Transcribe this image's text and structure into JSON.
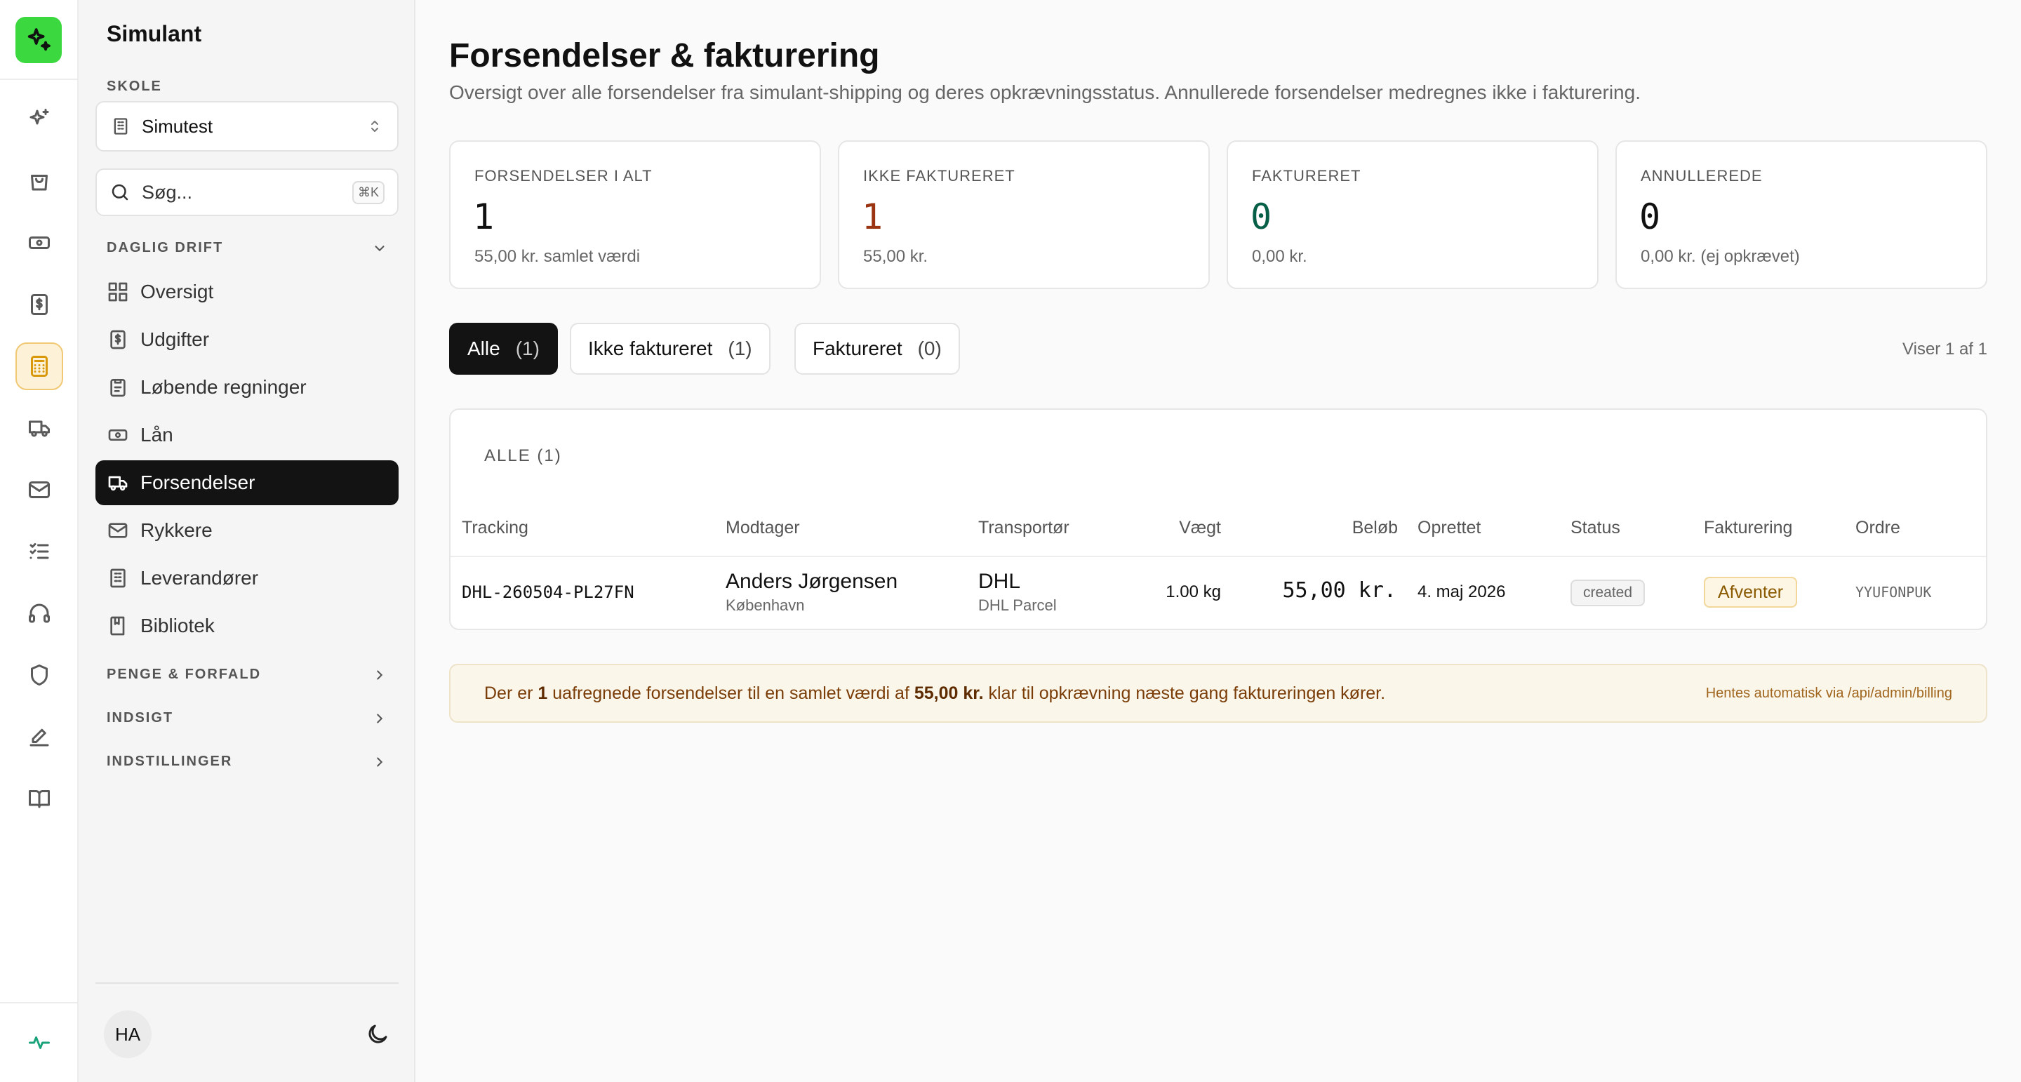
{
  "app": {
    "name": "Simulant"
  },
  "sidebar": {
    "school_label": "SKOLE",
    "school_value": "Simutest",
    "search_placeholder": "Søg...",
    "search_shortcut": "⌘K",
    "groups": [
      {
        "label": "DAGLIG DRIFT",
        "expanded": true,
        "items": [
          {
            "label": "Oversigt",
            "icon": "grid-icon"
          },
          {
            "label": "Udgifter",
            "icon": "dollar-doc-icon"
          },
          {
            "label": "Løbende regninger",
            "icon": "clipboard-icon"
          },
          {
            "label": "Lån",
            "icon": "banknote-icon"
          },
          {
            "label": "Forsendelser",
            "icon": "truck-icon",
            "active": true
          },
          {
            "label": "Rykkere",
            "icon": "mail-icon"
          },
          {
            "label": "Leverandører",
            "icon": "building-icon"
          },
          {
            "label": "Bibliotek",
            "icon": "book-icon"
          }
        ]
      },
      {
        "label": "PENGE & FORFALD",
        "expanded": false
      },
      {
        "label": "INDSIGT",
        "expanded": false
      },
      {
        "label": "INDSTILLINGER",
        "expanded": false
      }
    ],
    "user_initials": "HA"
  },
  "rail": {
    "icons": [
      "sparkles-icon",
      "shopping-bag-icon",
      "banknote-icon",
      "dollar-doc-icon",
      "calculator-icon",
      "truck-icon",
      "mail-icon",
      "list-checks-icon",
      "headphones-icon",
      "shield-icon",
      "pen-icon",
      "book-open-icon",
      "activity-icon"
    ],
    "active": "calculator-icon"
  },
  "page": {
    "title": "Forsendelser & fakturering",
    "subtitle": "Oversigt over alle forsendelser fra simulant-shipping og deres opkrævningsstatus. Annullerede forsendelser medregnes ikke i fakturering."
  },
  "stats": [
    {
      "label": "FORSENDELSER I ALT",
      "value": "1",
      "sub": "55,00 kr. samlet værdi",
      "color": "#111111"
    },
    {
      "label": "IKKE FAKTURERET",
      "value": "1",
      "sub": "55,00 kr.",
      "color": "#9a3412"
    },
    {
      "label": "FAKTURERET",
      "value": "0",
      "sub": "0,00 kr.",
      "color": "#065f46"
    },
    {
      "label": "ANNULLEREDE",
      "value": "0",
      "sub": "0,00 kr. (ej opkrævet)",
      "color": "#111111"
    }
  ],
  "tabs": [
    {
      "label": "Alle",
      "count": "(1)",
      "active": true
    },
    {
      "label": "Ikke faktureret",
      "count": "(1)"
    },
    {
      "label": "Faktureret",
      "count": "(0)"
    }
  ],
  "showing": "Viser 1 af 1",
  "table": {
    "title": "ALLE (1)",
    "columns": [
      "Tracking",
      "Modtager",
      "Transportør",
      "Vægt",
      "Beløb",
      "Oprettet",
      "Status",
      "Fakturering",
      "Ordre"
    ],
    "rows": [
      {
        "tracking": "DHL-260504-PL27FN",
        "recipient": "Anders Jørgensen",
        "city": "København",
        "carrier": "DHL",
        "service": "DHL Parcel",
        "weight": "1.00 kg",
        "amount": "55,00 kr.",
        "created": "4. maj 2026",
        "status": "created",
        "billing": "Afventer",
        "order": "YYUFONPUK"
      }
    ]
  },
  "notice": {
    "pre": "Der er",
    "count": "1",
    "mid": "uafregnede forsendelser til en samlet værdi af",
    "amount": "55,00 kr.",
    "post": "klar til opkrævning næste gang faktureringen kører.",
    "source": "Hentes automatisk via /api/admin/billing"
  }
}
